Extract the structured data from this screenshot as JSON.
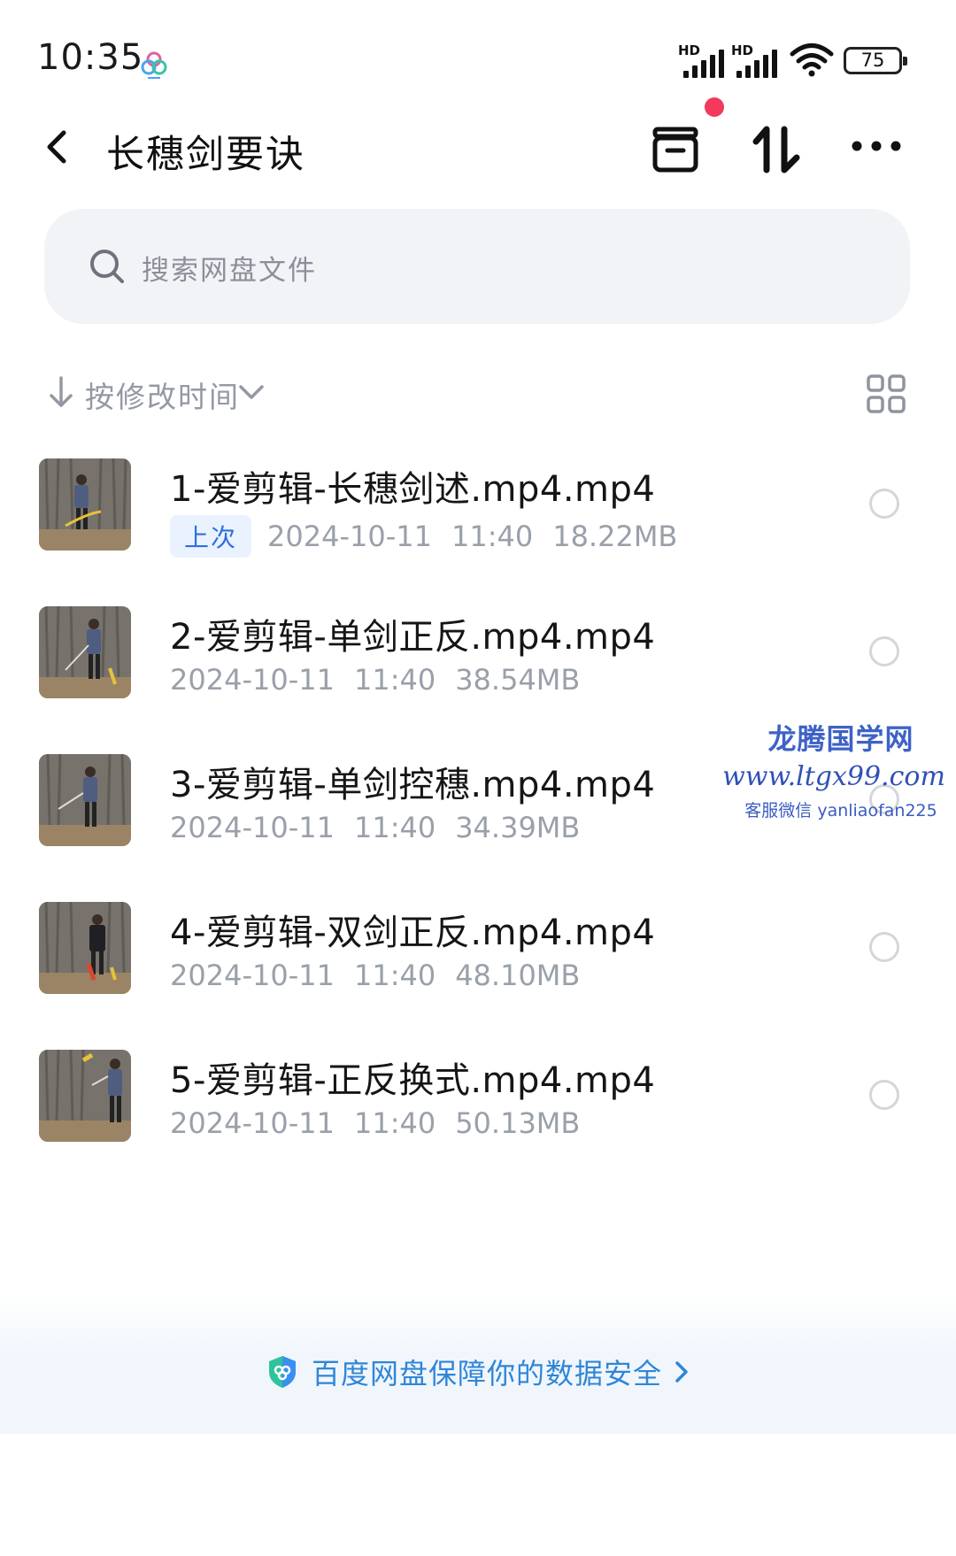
{
  "status_bar": {
    "time": "10:35",
    "signal_1_label": "HD",
    "signal_2_label": "HD",
    "battery": "75"
  },
  "header": {
    "title": "长穗剑要诀"
  },
  "search": {
    "placeholder": "搜索网盘文件"
  },
  "sort": {
    "label": "按修改时间"
  },
  "files": [
    {
      "name": "1-爱剪辑-长穗剑述.mp4.mp4",
      "badge": "上次",
      "date": "2024-10-11",
      "time": "11:40",
      "size": "18.22MB"
    },
    {
      "name": "2-爱剪辑-单剑正反.mp4.mp4",
      "date": "2024-10-11",
      "time": "11:40",
      "size": "38.54MB"
    },
    {
      "name": "3-爱剪辑-单剑控穗.mp4.mp4",
      "date": "2024-10-11",
      "time": "11:40",
      "size": "34.39MB"
    },
    {
      "name": "4-爱剪辑-双剑正反.mp4.mp4",
      "date": "2024-10-11",
      "time": "11:40",
      "size": "48.10MB"
    },
    {
      "name": "5-爱剪辑-正反换式.mp4.mp4",
      "date": "2024-10-11",
      "time": "11:40",
      "size": "50.13MB"
    }
  ],
  "watermark": {
    "title": "龙腾国学网",
    "url": "www.ltgx99.com",
    "contact": "客服微信 yanliaofan225"
  },
  "footer": {
    "text": "百度网盘保障你的数据安全"
  },
  "colors": {
    "accent": "#2f6fe0",
    "notification_dot": "#f13a5c",
    "footer_link": "#2f86d8",
    "watermark": "#3e62c7"
  }
}
